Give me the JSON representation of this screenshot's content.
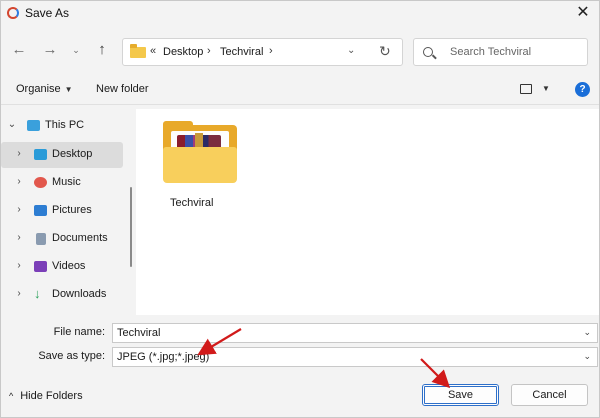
{
  "window": {
    "title": "Save As",
    "close_label": "✕"
  },
  "nav": {
    "back_icon": "back-arrow-icon",
    "forward_icon": "forward-arrow-icon",
    "recent_icon": "chevron-down-icon",
    "up_icon": "up-arrow-icon",
    "breadcrumb": {
      "overflow": "«",
      "items": [
        "Desktop",
        "Techviral"
      ],
      "separator": "›"
    },
    "search_placeholder": "Search Techviral"
  },
  "commands": {
    "organise": "Organise",
    "new_folder": "New folder"
  },
  "sidebar": {
    "root": "This PC",
    "items": [
      {
        "label": "Desktop",
        "icon": "desktop-icon",
        "color": "#2a9bd8",
        "selected": true
      },
      {
        "label": "Music",
        "icon": "music-icon",
        "color": "#e2574c"
      },
      {
        "label": "Pictures",
        "icon": "pictures-icon",
        "color": "#2d7dd2"
      },
      {
        "label": "Documents",
        "icon": "documents-icon",
        "color": "#8a9bb0"
      },
      {
        "label": "Videos",
        "icon": "videos-icon",
        "color": "#7b3fb8"
      },
      {
        "label": "Downloads",
        "icon": "downloads-icon",
        "color": "#2aa05a"
      }
    ]
  },
  "content": {
    "items": [
      {
        "name": "Techviral",
        "icon": "winrar-folder-icon"
      }
    ]
  },
  "form": {
    "file_name_label": "File name:",
    "file_name_value": "Techviral",
    "type_label": "Save as type:",
    "type_value": "JPEG (*.jpg;*.jpeg)"
  },
  "footer": {
    "hide_folders": "Hide Folders",
    "save": "Save",
    "cancel": "Cancel"
  },
  "colors": {
    "accent": "#2d6fc9",
    "annotation": "#d11a1a",
    "folder": "#f8cf5c"
  }
}
